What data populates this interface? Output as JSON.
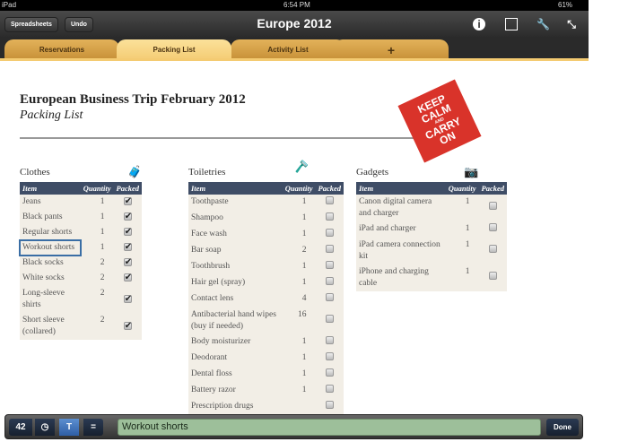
{
  "status": {
    "device": "iPad",
    "time": "6:54 PM",
    "battery": "61%"
  },
  "toolbar": {
    "spreadsheets": "Spreadsheets",
    "undo": "Undo",
    "title": "Europe 2012"
  },
  "tabs": [
    {
      "label": "Reservations"
    },
    {
      "label": "Packing List"
    },
    {
      "label": "Activity List"
    },
    {
      "label": "+"
    }
  ],
  "doc": {
    "title": "European Business Trip February 2012",
    "subtitle": "Packing List",
    "poster": [
      "KEEP",
      "CALM",
      "AND",
      "CARRY",
      "ON"
    ]
  },
  "headers": {
    "item": "Item",
    "quantity": "Quantity",
    "packed": "Packed"
  },
  "clothes": {
    "title": "Clothes",
    "rows": [
      {
        "item": "Jeans",
        "qty": "1",
        "packed": true
      },
      {
        "item": "Black pants",
        "qty": "1",
        "packed": true
      },
      {
        "item": "Regular shorts",
        "qty": "1",
        "packed": true
      },
      {
        "item": "Workout shorts",
        "qty": "1",
        "packed": true
      },
      {
        "item": "Black socks",
        "qty": "2",
        "packed": true
      },
      {
        "item": "White socks",
        "qty": "2",
        "packed": true
      },
      {
        "item": "Long-sleeve shirts",
        "qty": "2",
        "packed": true
      },
      {
        "item": "Short sleeve (collared)",
        "qty": "2",
        "packed": true
      }
    ]
  },
  "toiletries": {
    "title": "Toiletries",
    "rows": [
      {
        "item": "Toothpaste",
        "qty": "1",
        "packed": false
      },
      {
        "item": "Shampoo",
        "qty": "1",
        "packed": false
      },
      {
        "item": "Face wash",
        "qty": "1",
        "packed": false
      },
      {
        "item": "Bar soap",
        "qty": "2",
        "packed": false
      },
      {
        "item": "Toothbrush",
        "qty": "1",
        "packed": false
      },
      {
        "item": "Hair gel (spray)",
        "qty": "1",
        "packed": false
      },
      {
        "item": "Contact lens",
        "qty": "4",
        "packed": false
      },
      {
        "item": "Antibacterial hand wipes (buy if needed)",
        "qty": "16",
        "packed": false
      },
      {
        "item": "Body moisturizer",
        "qty": "1",
        "packed": false
      },
      {
        "item": "Deodorant",
        "qty": "1",
        "packed": false
      },
      {
        "item": "Dental floss",
        "qty": "1",
        "packed": false
      },
      {
        "item": "Battery razor",
        "qty": "1",
        "packed": false
      },
      {
        "item": "Prescription drugs",
        "qty": "",
        "packed": false
      }
    ]
  },
  "gadgets": {
    "title": "Gadgets",
    "rows": [
      {
        "item": "Canon digital camera and charger",
        "qty": "1",
        "packed": false
      },
      {
        "item": "iPad and charger",
        "qty": "1",
        "packed": false
      },
      {
        "item": "iPad camera connection kit",
        "qty": "1",
        "packed": false
      },
      {
        "item": "iPhone and charging cable",
        "qty": "1",
        "packed": false
      }
    ]
  },
  "editbar": {
    "number_key": "42",
    "value": "Workout shorts",
    "done": "Done"
  }
}
